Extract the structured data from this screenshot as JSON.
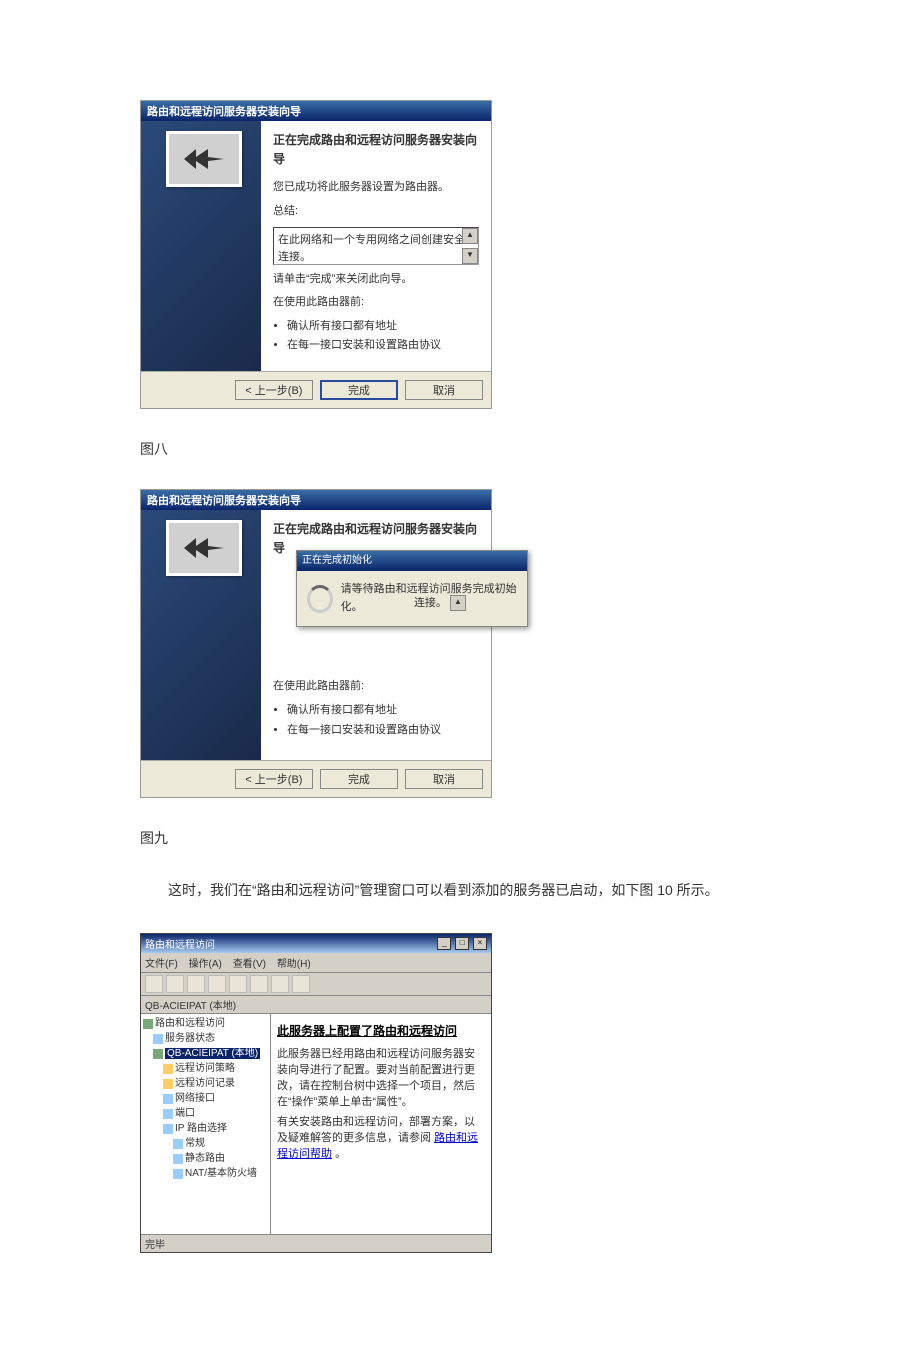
{
  "wizard1": {
    "titlebar": "路由和远程访问服务器安装向导",
    "heading": "正在完成路由和远程访问服务器安装向导",
    "line1": "您已成功将此服务器设置为路由器。",
    "summary_label": "总结:",
    "summary_box": "在此网络和一个专用网络之间创建安全连接。",
    "close_hint": "请单击“完成”来关闭此向导。",
    "before_use": "在使用此路由器前:",
    "bullet1": "确认所有接口都有地址",
    "bullet2": "在每一接口安装和设置路由协议",
    "btn_back": "< 上一步(B)",
    "btn_finish": "完成",
    "btn_cancel": "取消"
  },
  "caption1": "图八",
  "wizard2": {
    "titlebar": "路由和远程访问服务器安装向导",
    "heading": "正在完成路由和远程访问服务器安装向导",
    "inner_title": "正在完成初始化",
    "inner_msg": "请等待路由和远程访问服务完成初始化。",
    "conn_tail": "连接。",
    "before_use": "在使用此路由器前:",
    "bullet1": "确认所有接口都有地址",
    "bullet2": "在每一接口安装和设置路由协议",
    "btn_back": "< 上一步(B)",
    "btn_finish": "完成",
    "btn_cancel": "取消"
  },
  "caption2": "图九",
  "paragraph": "这时，我们在“路由和远程访问”管理窗口可以看到添加的服务器已启动，如下图 10 所示。",
  "mmc": {
    "title": "路由和远程访问",
    "menu": {
      "file": "文件(F)",
      "action": "操作(A)",
      "view": "查看(V)",
      "help": "帮助(H)"
    },
    "pathbar": "QB-ACIEIPAT (本地)",
    "tree": {
      "root": "路由和远程访问",
      "status": "服务器状态",
      "server": "QB-ACIEIPAT (本地)",
      "policy": "远程访问策略",
      "log": "远程访问记录",
      "netif": "网络接口",
      "ports": "端口",
      "iproute": "IP 路由选择",
      "general": "常规",
      "static": "静态路由",
      "nat": "NAT/基本防火墙"
    },
    "right": {
      "heading": "此服务器上配置了路由和远程访问",
      "p1": "此服务器已经用路由和远程访问服务器安装向导进行了配置。要对当前配置进行更改，请在控制台树中选择一个项目，然后在“操作”菜单上单击“属性”。",
      "p2_a": "有关安装路由和远程访问，部署方案，以及疑难解答的更多信息，请参阅",
      "p2_link": "路由和远程访问帮助",
      "p2_b": "。"
    },
    "status_bar": "完毕"
  }
}
